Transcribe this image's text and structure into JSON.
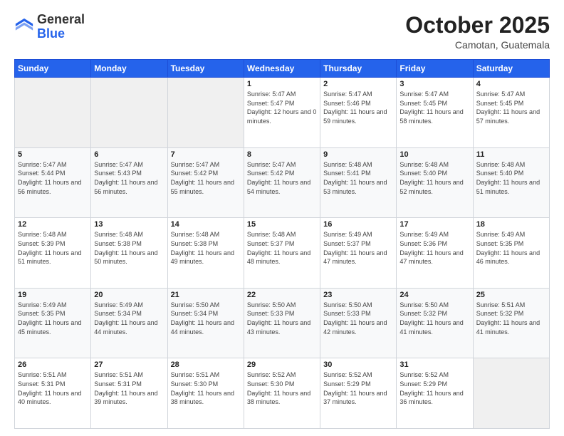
{
  "header": {
    "logo_general": "General",
    "logo_blue": "Blue",
    "month_title": "October 2025",
    "location": "Camotan, Guatemala"
  },
  "weekdays": [
    "Sunday",
    "Monday",
    "Tuesday",
    "Wednesday",
    "Thursday",
    "Friday",
    "Saturday"
  ],
  "weeks": [
    [
      {
        "day": "",
        "sunrise": "",
        "sunset": "",
        "daylight": ""
      },
      {
        "day": "",
        "sunrise": "",
        "sunset": "",
        "daylight": ""
      },
      {
        "day": "",
        "sunrise": "",
        "sunset": "",
        "daylight": ""
      },
      {
        "day": "1",
        "sunrise": "Sunrise: 5:47 AM",
        "sunset": "Sunset: 5:47 PM",
        "daylight": "Daylight: 12 hours and 0 minutes."
      },
      {
        "day": "2",
        "sunrise": "Sunrise: 5:47 AM",
        "sunset": "Sunset: 5:46 PM",
        "daylight": "Daylight: 11 hours and 59 minutes."
      },
      {
        "day": "3",
        "sunrise": "Sunrise: 5:47 AM",
        "sunset": "Sunset: 5:45 PM",
        "daylight": "Daylight: 11 hours and 58 minutes."
      },
      {
        "day": "4",
        "sunrise": "Sunrise: 5:47 AM",
        "sunset": "Sunset: 5:45 PM",
        "daylight": "Daylight: 11 hours and 57 minutes."
      }
    ],
    [
      {
        "day": "5",
        "sunrise": "Sunrise: 5:47 AM",
        "sunset": "Sunset: 5:44 PM",
        "daylight": "Daylight: 11 hours and 56 minutes."
      },
      {
        "day": "6",
        "sunrise": "Sunrise: 5:47 AM",
        "sunset": "Sunset: 5:43 PM",
        "daylight": "Daylight: 11 hours and 56 minutes."
      },
      {
        "day": "7",
        "sunrise": "Sunrise: 5:47 AM",
        "sunset": "Sunset: 5:42 PM",
        "daylight": "Daylight: 11 hours and 55 minutes."
      },
      {
        "day": "8",
        "sunrise": "Sunrise: 5:47 AM",
        "sunset": "Sunset: 5:42 PM",
        "daylight": "Daylight: 11 hours and 54 minutes."
      },
      {
        "day": "9",
        "sunrise": "Sunrise: 5:48 AM",
        "sunset": "Sunset: 5:41 PM",
        "daylight": "Daylight: 11 hours and 53 minutes."
      },
      {
        "day": "10",
        "sunrise": "Sunrise: 5:48 AM",
        "sunset": "Sunset: 5:40 PM",
        "daylight": "Daylight: 11 hours and 52 minutes."
      },
      {
        "day": "11",
        "sunrise": "Sunrise: 5:48 AM",
        "sunset": "Sunset: 5:40 PM",
        "daylight": "Daylight: 11 hours and 51 minutes."
      }
    ],
    [
      {
        "day": "12",
        "sunrise": "Sunrise: 5:48 AM",
        "sunset": "Sunset: 5:39 PM",
        "daylight": "Daylight: 11 hours and 51 minutes."
      },
      {
        "day": "13",
        "sunrise": "Sunrise: 5:48 AM",
        "sunset": "Sunset: 5:38 PM",
        "daylight": "Daylight: 11 hours and 50 minutes."
      },
      {
        "day": "14",
        "sunrise": "Sunrise: 5:48 AM",
        "sunset": "Sunset: 5:38 PM",
        "daylight": "Daylight: 11 hours and 49 minutes."
      },
      {
        "day": "15",
        "sunrise": "Sunrise: 5:48 AM",
        "sunset": "Sunset: 5:37 PM",
        "daylight": "Daylight: 11 hours and 48 minutes."
      },
      {
        "day": "16",
        "sunrise": "Sunrise: 5:49 AM",
        "sunset": "Sunset: 5:37 PM",
        "daylight": "Daylight: 11 hours and 47 minutes."
      },
      {
        "day": "17",
        "sunrise": "Sunrise: 5:49 AM",
        "sunset": "Sunset: 5:36 PM",
        "daylight": "Daylight: 11 hours and 47 minutes."
      },
      {
        "day": "18",
        "sunrise": "Sunrise: 5:49 AM",
        "sunset": "Sunset: 5:35 PM",
        "daylight": "Daylight: 11 hours and 46 minutes."
      }
    ],
    [
      {
        "day": "19",
        "sunrise": "Sunrise: 5:49 AM",
        "sunset": "Sunset: 5:35 PM",
        "daylight": "Daylight: 11 hours and 45 minutes."
      },
      {
        "day": "20",
        "sunrise": "Sunrise: 5:49 AM",
        "sunset": "Sunset: 5:34 PM",
        "daylight": "Daylight: 11 hours and 44 minutes."
      },
      {
        "day": "21",
        "sunrise": "Sunrise: 5:50 AM",
        "sunset": "Sunset: 5:34 PM",
        "daylight": "Daylight: 11 hours and 44 minutes."
      },
      {
        "day": "22",
        "sunrise": "Sunrise: 5:50 AM",
        "sunset": "Sunset: 5:33 PM",
        "daylight": "Daylight: 11 hours and 43 minutes."
      },
      {
        "day": "23",
        "sunrise": "Sunrise: 5:50 AM",
        "sunset": "Sunset: 5:33 PM",
        "daylight": "Daylight: 11 hours and 42 minutes."
      },
      {
        "day": "24",
        "sunrise": "Sunrise: 5:50 AM",
        "sunset": "Sunset: 5:32 PM",
        "daylight": "Daylight: 11 hours and 41 minutes."
      },
      {
        "day": "25",
        "sunrise": "Sunrise: 5:51 AM",
        "sunset": "Sunset: 5:32 PM",
        "daylight": "Daylight: 11 hours and 41 minutes."
      }
    ],
    [
      {
        "day": "26",
        "sunrise": "Sunrise: 5:51 AM",
        "sunset": "Sunset: 5:31 PM",
        "daylight": "Daylight: 11 hours and 40 minutes."
      },
      {
        "day": "27",
        "sunrise": "Sunrise: 5:51 AM",
        "sunset": "Sunset: 5:31 PM",
        "daylight": "Daylight: 11 hours and 39 minutes."
      },
      {
        "day": "28",
        "sunrise": "Sunrise: 5:51 AM",
        "sunset": "Sunset: 5:30 PM",
        "daylight": "Daylight: 11 hours and 38 minutes."
      },
      {
        "day": "29",
        "sunrise": "Sunrise: 5:52 AM",
        "sunset": "Sunset: 5:30 PM",
        "daylight": "Daylight: 11 hours and 38 minutes."
      },
      {
        "day": "30",
        "sunrise": "Sunrise: 5:52 AM",
        "sunset": "Sunset: 5:29 PM",
        "daylight": "Daylight: 11 hours and 37 minutes."
      },
      {
        "day": "31",
        "sunrise": "Sunrise: 5:52 AM",
        "sunset": "Sunset: 5:29 PM",
        "daylight": "Daylight: 11 hours and 36 minutes."
      },
      {
        "day": "",
        "sunrise": "",
        "sunset": "",
        "daylight": ""
      }
    ]
  ]
}
